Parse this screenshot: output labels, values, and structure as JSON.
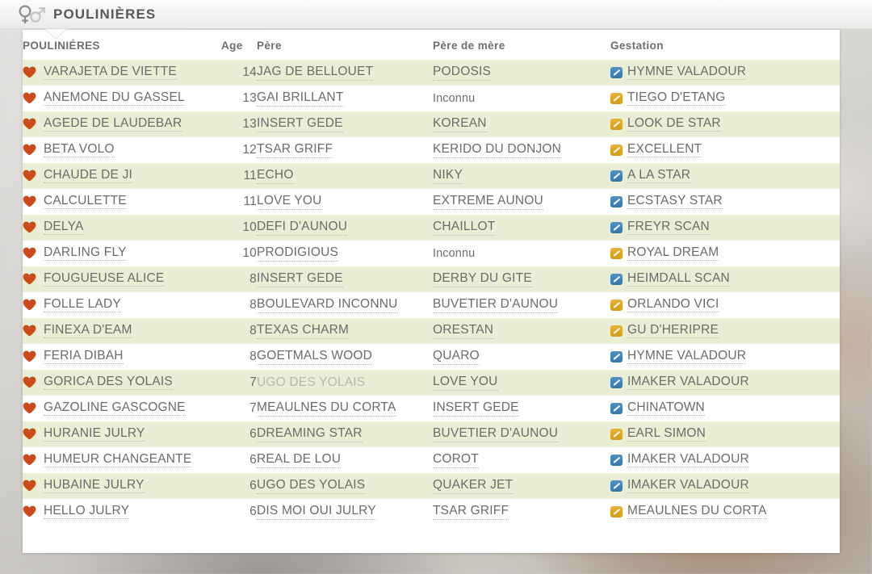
{
  "header": {
    "title": "POULINIÈRES",
    "icon": "female-male-symbol-icon"
  },
  "table": {
    "columns": {
      "name": "POULINIÉRES",
      "age": "Age",
      "pere": "Père",
      "pere_de_mere": "Père de mère",
      "gestation": "Gestation"
    },
    "rows": [
      {
        "name": "VARAJETA DE VIETTE",
        "age": "14",
        "pere": "JAG DE BELLOUET",
        "pere_de_mere": "PODOSIS",
        "gestation": "HYMNE VALADOUR",
        "gestation_color": "blue",
        "pere_muted": false,
        "pdm_unknown": false
      },
      {
        "name": "ANEMONE DU GASSEL",
        "age": "13",
        "pere": "GAI BRILLANT",
        "pere_de_mere": "Inconnu",
        "gestation": "TIEGO D'ETANG",
        "gestation_color": "yellow",
        "pere_muted": false,
        "pdm_unknown": true
      },
      {
        "name": "AGEDE DE LAUDEBAR",
        "age": "13",
        "pere": "INSERT GEDE",
        "pere_de_mere": "KOREAN",
        "gestation": "LOOK DE STAR",
        "gestation_color": "yellow",
        "pere_muted": false,
        "pdm_unknown": false
      },
      {
        "name": "BETA VOLO",
        "age": "12",
        "pere": "TSAR GRIFF",
        "pere_de_mere": "KERIDO DU DONJON",
        "gestation": "EXCELLENT",
        "gestation_color": "yellow",
        "pere_muted": false,
        "pdm_unknown": false
      },
      {
        "name": "CHAUDE DE JI",
        "age": "11",
        "pere": "ECHO",
        "pere_de_mere": "NIKY",
        "gestation": "A LA STAR",
        "gestation_color": "blue",
        "pere_muted": false,
        "pdm_unknown": false
      },
      {
        "name": "CALCULETTE",
        "age": "11",
        "pere": "LOVE YOU",
        "pere_de_mere": "EXTREME AUNOU",
        "gestation": "ECSTASY STAR",
        "gestation_color": "blue",
        "pere_muted": false,
        "pdm_unknown": false
      },
      {
        "name": "DELYA",
        "age": "10",
        "pere": "DEFI D'AUNOU",
        "pere_de_mere": "CHAILLOT",
        "gestation": "FREYR SCAN",
        "gestation_color": "blue",
        "pere_muted": false,
        "pdm_unknown": false
      },
      {
        "name": "DARLING FLY",
        "age": "10",
        "pere": "PRODIGIOUS",
        "pere_de_mere": "Inconnu",
        "gestation": "ROYAL DREAM",
        "gestation_color": "yellow",
        "pere_muted": false,
        "pdm_unknown": true
      },
      {
        "name": "FOUGUEUSE ALICE",
        "age": "8",
        "pere": "INSERT GEDE",
        "pere_de_mere": "DERBY DU GITE",
        "gestation": "HEIMDALL SCAN",
        "gestation_color": "blue",
        "pere_muted": false,
        "pdm_unknown": false
      },
      {
        "name": "FOLLE LADY",
        "age": "8",
        "pere": "BOULEVARD INCONNU",
        "pere_de_mere": "BUVETIER D'AUNOU",
        "gestation": "ORLANDO VICI",
        "gestation_color": "yellow",
        "pere_muted": false,
        "pdm_unknown": false
      },
      {
        "name": "FINEXA D'EAM",
        "age": "8",
        "pere": "TEXAS CHARM",
        "pere_de_mere": "ORESTAN",
        "gestation": "GU D'HERIPRE",
        "gestation_color": "yellow",
        "pere_muted": false,
        "pdm_unknown": false
      },
      {
        "name": "FERIA DIBAH",
        "age": "8",
        "pere": "GOETMALS WOOD",
        "pere_de_mere": "QUARO",
        "gestation": "HYMNE VALADOUR",
        "gestation_color": "blue",
        "pere_muted": false,
        "pdm_unknown": false
      },
      {
        "name": "GORICA DES YOLAIS",
        "age": "7",
        "pere": "UGO DES YOLAIS",
        "pere_de_mere": "LOVE YOU",
        "gestation": "IMAKER VALADOUR",
        "gestation_color": "blue",
        "pere_muted": true,
        "pdm_unknown": false
      },
      {
        "name": "GAZOLINE GASCOGNE",
        "age": "7",
        "pere": "MEAULNES DU CORTA",
        "pere_de_mere": "INSERT GEDE",
        "gestation": "CHINATOWN",
        "gestation_color": "blue",
        "pere_muted": false,
        "pdm_unknown": false
      },
      {
        "name": "HURANIE JULRY",
        "age": "6",
        "pere": "DREAMING STAR",
        "pere_de_mere": "BUVETIER D'AUNOU",
        "gestation": "EARL SIMON",
        "gestation_color": "yellow",
        "pere_muted": false,
        "pdm_unknown": false
      },
      {
        "name": "HUMEUR CHANGEANTE",
        "age": "6",
        "pere": "REAL DE LOU",
        "pere_de_mere": "COROT",
        "gestation": "IMAKER VALADOUR",
        "gestation_color": "blue",
        "pere_muted": false,
        "pdm_unknown": false
      },
      {
        "name": "HUBAINE JULRY",
        "age": "6",
        "pere": "UGO DES YOLAIS",
        "pere_de_mere": "QUAKER JET",
        "gestation": "IMAKER VALADOUR",
        "gestation_color": "blue",
        "pere_muted": false,
        "pdm_unknown": false
      },
      {
        "name": "HELLO JULRY",
        "age": "6",
        "pere": "DIS MOI OUI JULRY",
        "pere_de_mere": "TSAR GRIFF",
        "gestation": "MEAULNES DU CORTA",
        "gestation_color": "yellow",
        "pere_muted": false,
        "pdm_unknown": false
      }
    ]
  },
  "colors": {
    "row_alt": "#eaeed4",
    "row_plain": "#ffffff",
    "text": "#6b6b6b",
    "heart": "#cc4a19",
    "icon_blue": "#2f79ae",
    "icon_yellow": "#d79a12",
    "header_text": "#58585a"
  }
}
